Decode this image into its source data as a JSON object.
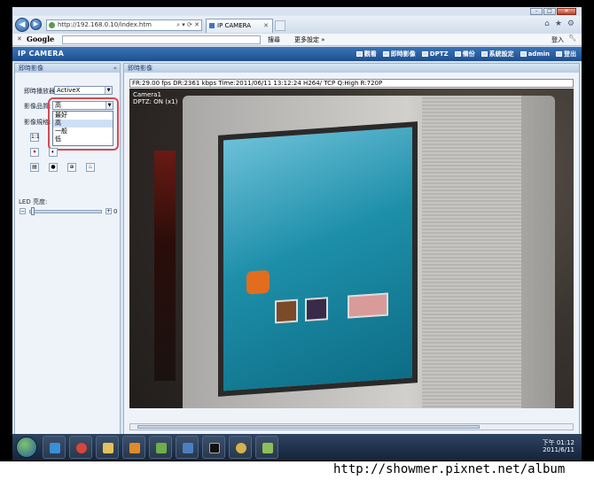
{
  "browser": {
    "address_url": "http://192.168.0.10/index.htm",
    "tab_title": "IP CAMERA",
    "google_logo": "Google",
    "google_search_label": "搜尋",
    "google_more_label": "更多設定 »",
    "google_login_label": "登入"
  },
  "app": {
    "title": "IP CAMERA",
    "nav": [
      {
        "label": "觀看",
        "icon": "eye-icon"
      },
      {
        "label": "即時影像",
        "icon": "video-icon"
      },
      {
        "label": "DPTZ",
        "icon": "ptz-icon"
      },
      {
        "label": "備份",
        "icon": "backup-icon"
      },
      {
        "label": "系統設定",
        "icon": "settings-icon"
      },
      {
        "label": "admin",
        "icon": "user-icon"
      },
      {
        "label": "登出",
        "icon": "logout-icon"
      }
    ]
  },
  "left_panel": {
    "header": "即時影像",
    "player_label": "即時播放器:",
    "player_value": "ActiveX",
    "quality_label": "影像品質:",
    "quality_value": "高",
    "quality_options": [
      "最好",
      "高",
      "一般",
      "低"
    ],
    "quality_highlight_index": 1,
    "size_label": "影像規格:",
    "led_label": "LED 亮度:",
    "led_value": "0",
    "led_level_fraction": 0.0
  },
  "main_panel": {
    "header": "即時影像",
    "status_line": "FR:29.00 fps  DR:2361 kbps Time:2011/06/11 13:12:24 H264/ TCP Q:High R:720P",
    "osd_camera": "Camera1",
    "osd_dptz": "DPTZ: ON (x1)"
  },
  "taskbar": {
    "time": "下午 01:12",
    "date": "2011/6/11"
  },
  "watermark": "http://showmer.pixnet.net/album",
  "colors": {
    "accent": "#1e4f8f",
    "highlight_ring": "#d44a55"
  }
}
